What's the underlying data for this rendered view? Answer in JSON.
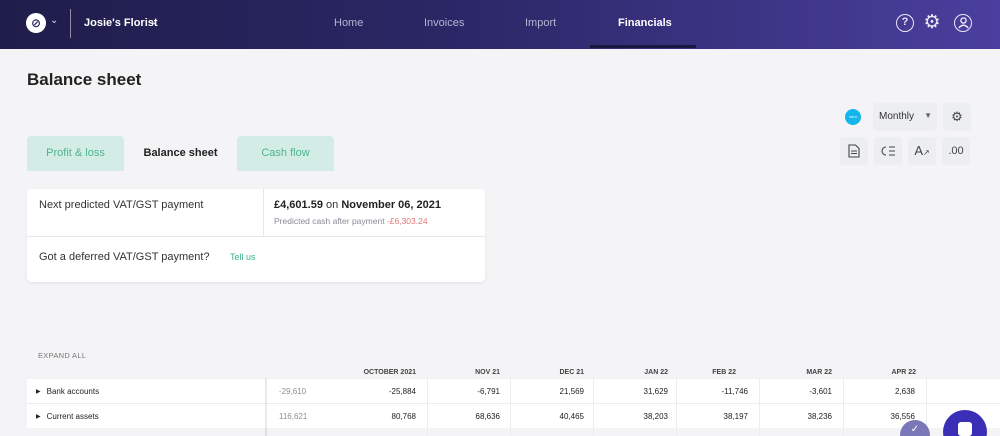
{
  "header": {
    "logo_glyph": "⊘",
    "org_name": "Josie's Florist",
    "nav": [
      "Home",
      "Invoices",
      "Import",
      "Financials"
    ],
    "active_nav": "Financials",
    "icons": [
      "help-icon",
      "gear-icon",
      "user-icon"
    ],
    "brand_colors": {
      "bar_start": "#1f1d4a",
      "bar_end": "#4a3f9e"
    }
  },
  "page": {
    "title": "Balance sheet"
  },
  "controls": {
    "xero_badge": "xero",
    "period_value": "Monthly",
    "currency_format_label": ".00",
    "icons": [
      "settings-icon",
      "document-icon",
      "list-icon",
      "font-icon"
    ]
  },
  "tabs": [
    {
      "label": "Profit & loss",
      "active": false
    },
    {
      "label": "Balance sheet",
      "active": true
    },
    {
      "label": "Cash flow",
      "active": false
    }
  ],
  "vat": {
    "label": "Next predicted VAT/GST payment",
    "amount": "£4,601.59",
    "on_word": "on",
    "date": "November 06, 2021",
    "predicted_label": "Predicted cash after payment",
    "predicted_value": "-£6,303.24",
    "deferred_label": "Got a deferred VAT/GST payment?",
    "tell_us": "Tell us"
  },
  "table": {
    "expand_all": "EXPAND ALL",
    "columns": [
      "OCTOBER 2021",
      "NOV 21",
      "DEC 21",
      "JAN 22",
      "FEB 22",
      "MAR 22",
      "APR 22"
    ],
    "rows": [
      {
        "label": "Bank accounts",
        "opening": "-29,610",
        "values": [
          "-25,884",
          "-6,791",
          "21,569",
          "31,629",
          "-11,746",
          "-3,601",
          "2,638"
        ]
      },
      {
        "label": "Current assets",
        "opening": "116,621",
        "values": [
          "80,768",
          "68,636",
          "40,465",
          "38,203",
          "38,197",
          "38,236",
          "36,556"
        ]
      }
    ]
  }
}
